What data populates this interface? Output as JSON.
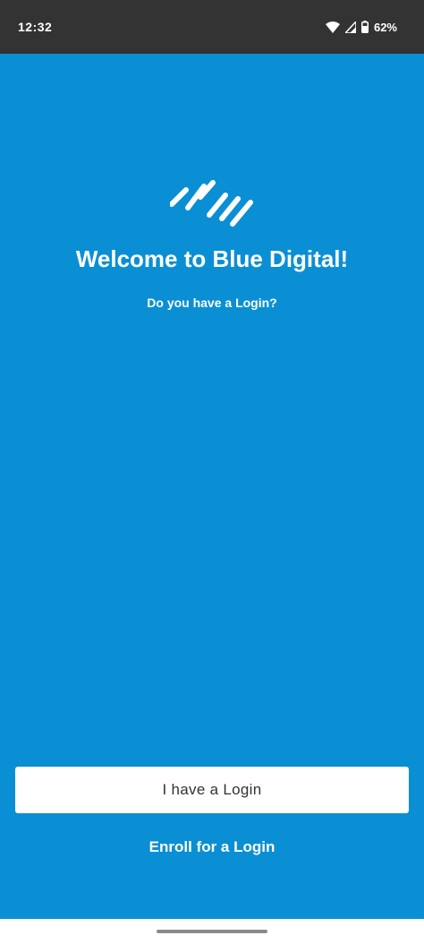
{
  "status_bar": {
    "time": "12:32",
    "battery_text": "62%",
    "icons": [
      "wifi-icon",
      "signal-icon",
      "battery-icon"
    ]
  },
  "welcome": {
    "logo": "blue-digital-logo-icon",
    "title": "Welcome to Blue Digital!",
    "subtitle": "Do you have a Login?"
  },
  "actions": {
    "login_label": "I have a Login",
    "enroll_label": "Enroll for a Login"
  },
  "colors": {
    "background": "#0A8FD4",
    "status_bar": "#333333",
    "button": "#FFFFFF",
    "text_light": "#FFFFFF",
    "button_text": "#333333"
  }
}
